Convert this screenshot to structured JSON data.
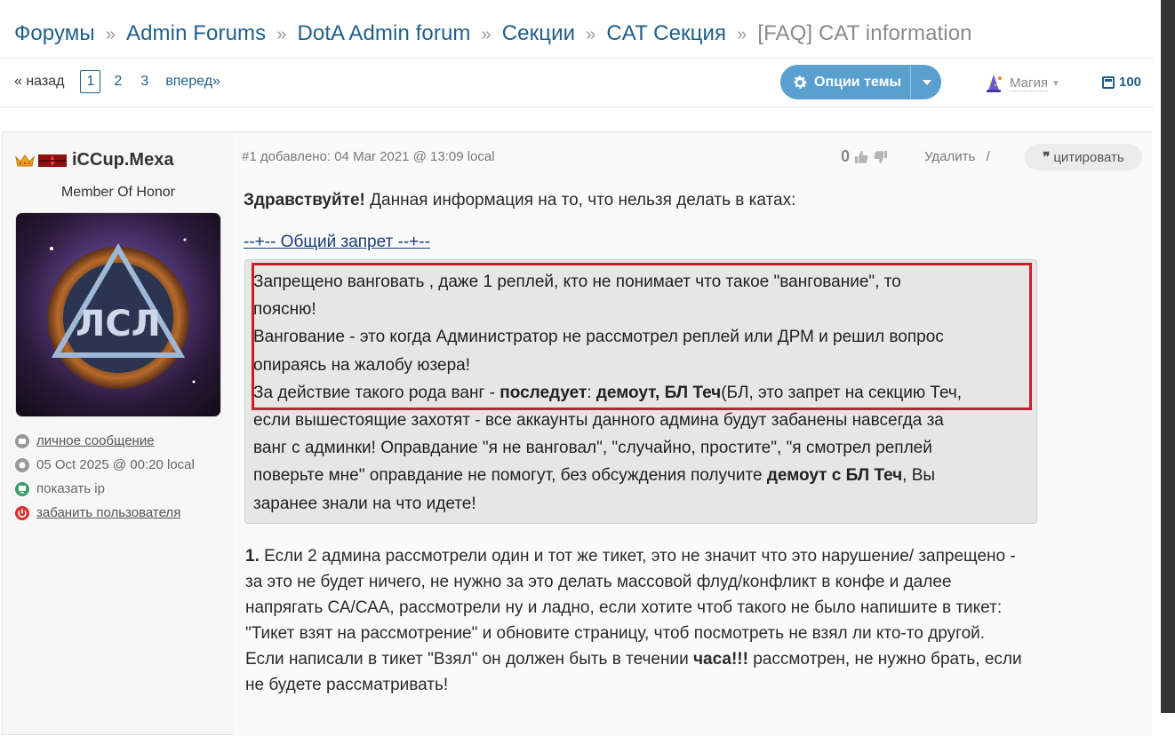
{
  "breadcrumb": {
    "items": [
      "Форумы",
      "Admin Forums",
      "DotA Admin forum",
      "Секции",
      "CAT Секция"
    ],
    "current": "[FAQ] CAT information",
    "separator": "»"
  },
  "pager": {
    "back": "« назад",
    "pages": [
      "1",
      "2",
      "3"
    ],
    "active_page": "1",
    "forward": "вперед»"
  },
  "toolbar": {
    "options_label": "Опции темы",
    "magic_label": "Магия",
    "count": "100"
  },
  "user": {
    "name": "iCCup.Mexa",
    "title": "Member Of Honor",
    "pm": "личное сообщение",
    "last_seen": "05 Oct 2025 @ 00:20 local",
    "show_ip": "показать ip",
    "ban": "забанить пользователя"
  },
  "post": {
    "meta": "#1 добавлено: 04 Mar 2021 @ 13:09 local",
    "score": "0",
    "delete": "Удалить",
    "delete_sep": "/",
    "quote": "цитировать",
    "greet_bold": "Здравствуйте!",
    "greet_text": " Данная информация на то, что нельзя делать в катах:",
    "spoiler_title": "--+-- Общий запрет --+--",
    "box": {
      "line1": "Запрещено ванговать , даже 1 реплей, кто не понимает что такое \"вангование\", то",
      "line2": "поясню!",
      "line3": "Вангование - это когда Администратор не рассмотрел реплей или ДРМ и решил вопрос",
      "line4": "опираясь на жалобу юзера!",
      "line5a": "За действие такого рода ванг - ",
      "line5b": "последует",
      "line5c": ": ",
      "line5d": "демоут, БЛ Теч",
      "line5e": "(БЛ, это запрет на секцию Теч,",
      "line6": "если вышестоящие захотят - все аккаунты данного админа будут забанены навсегда за",
      "line7": "ванг с админки! Оправдание \"я не ванговал\", \"случайно, простите\", \"я смотрел реплей",
      "line8": "поверьте мне\" оправдание не помогут, без обсуждения получите ",
      "line8b": "демоут с БЛ Теч",
      "line8c": ", Вы",
      "line9": "заранее знали на что идете!"
    },
    "para1": {
      "num": "1.",
      "text": " Если 2 админа рассмотрели один и тот же тикет, это не значит что это нарушение/ запрещено - за это не будет ничего, не нужно за это делать массовой флуд/конфликт в конфе и далее напрягать СА/САА, рассмотрели ну и ладно, если хотите чтоб такого не было напишите в тикет: \"Тикет взят на рассмотрение\" и обновите страницу, чтоб посмотреть не взял ли кто-то другой. Если написали в тикет \"Взял\" он должен быть в течении ",
      "bold": "часа!!!",
      "tail": " рассмотрен, не нужно брать, если не будете рассматривать!"
    }
  }
}
